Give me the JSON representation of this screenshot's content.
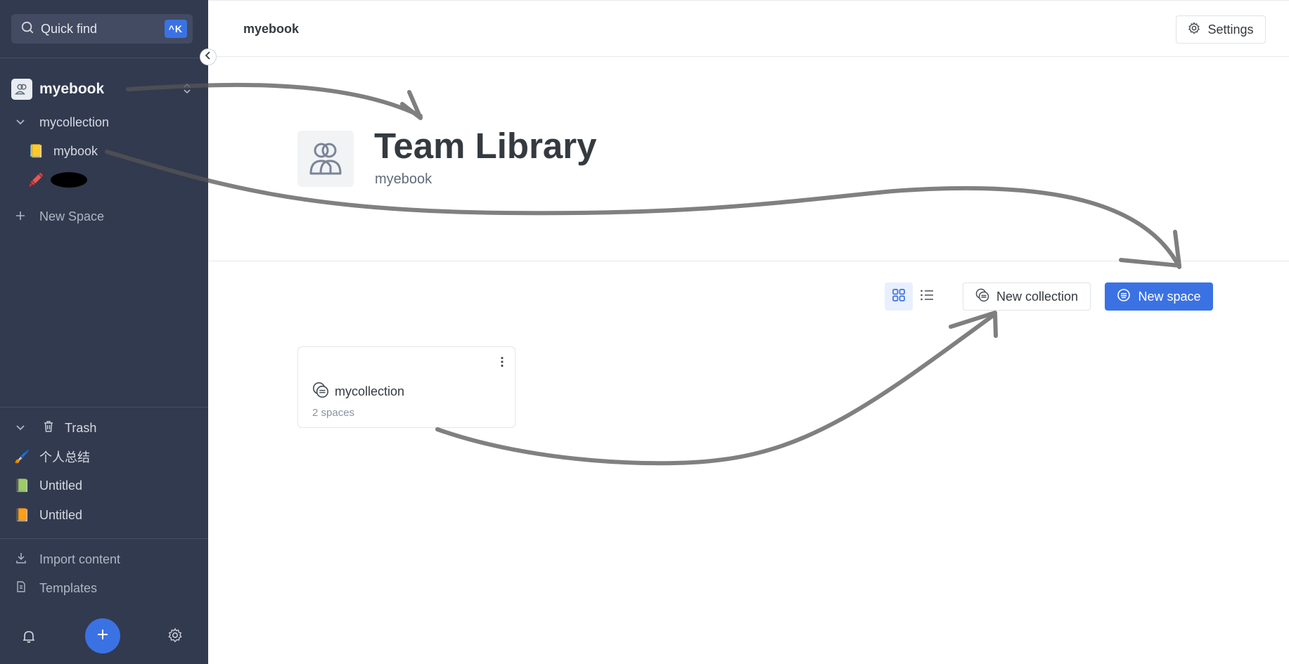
{
  "sidebar": {
    "quick_find": {
      "label": "Quick find",
      "shortcut": "^K"
    },
    "workspace": {
      "name": "myebook"
    },
    "tree": [
      {
        "label": "mycollection",
        "type": "collection"
      },
      {
        "label": "mybook",
        "icon": "notebook-emoji"
      },
      {
        "label": "",
        "icon": "crayon-emoji",
        "redacted": true
      }
    ],
    "new_space_label": "New Space",
    "trash": {
      "label": "Trash"
    },
    "trash_items": [
      {
        "label": "个人总结",
        "icon": "paintbrush-emoji"
      },
      {
        "label": "Untitled",
        "icon": "green-book-emoji"
      },
      {
        "label": "Untitled",
        "icon": "orange-book-emoji"
      }
    ],
    "import_label": "Import content",
    "templates_label": "Templates",
    "icons": [
      "bell-icon",
      "plus-icon",
      "gear-icon"
    ]
  },
  "header": {
    "breadcrumb": "myebook",
    "settings_label": "Settings"
  },
  "hero": {
    "title": "Team Library",
    "subtitle": "myebook"
  },
  "toolbar": {
    "new_collection_label": "New collection",
    "new_space_label": "New space"
  },
  "cards": [
    {
      "title": "mycollection",
      "subtitle": "2 spaces"
    }
  ],
  "colors": {
    "sidebar_bg": "#323a4f",
    "accent": "#3b72e3",
    "text": "#343a40"
  }
}
